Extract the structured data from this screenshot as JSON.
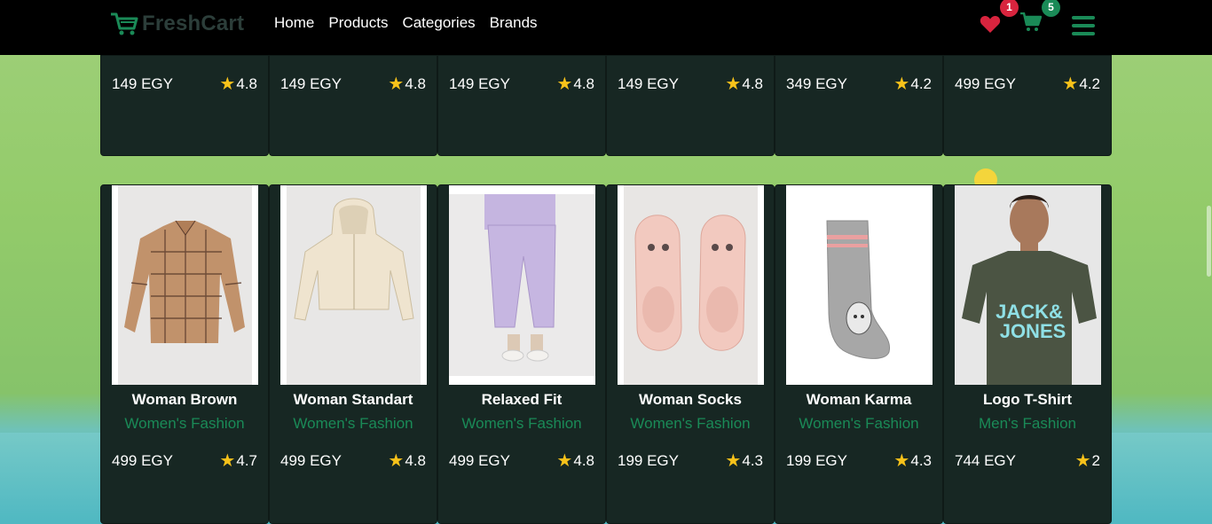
{
  "brand": {
    "name": "FreshCart"
  },
  "nav": {
    "links": [
      "Home",
      "Products",
      "Categories",
      "Brands"
    ],
    "wishlist_count": "1",
    "cart_count": "5"
  },
  "colors": {
    "accent": "#1a8a57",
    "card_bg": "#172723",
    "star": "#f7c21a",
    "badge_red": "#d8243e"
  },
  "top_row": [
    {
      "price": "149 EGY",
      "rating": "4.8"
    },
    {
      "price": "149 EGY",
      "rating": "4.8"
    },
    {
      "price": "149 EGY",
      "rating": "4.8"
    },
    {
      "price": "149 EGY",
      "rating": "4.8"
    },
    {
      "price": "349 EGY",
      "rating": "4.2"
    },
    {
      "price": "499 EGY",
      "rating": "4.2"
    }
  ],
  "products": [
    {
      "title": "Woman Brown",
      "category": "Women's Fashion",
      "price": "499 EGY",
      "rating": "4.7",
      "image": "plaid-shirt"
    },
    {
      "title": "Woman Standart",
      "category": "Women's Fashion",
      "price": "499 EGY",
      "rating": "4.8",
      "image": "cream-hoodie"
    },
    {
      "title": "Relaxed Fit",
      "category": "Women's Fashion",
      "price": "499 EGY",
      "rating": "4.8",
      "image": "lilac-joggers"
    },
    {
      "title": "Woman Socks",
      "category": "Women's Fashion",
      "price": "199 EGY",
      "rating": "4.3",
      "image": "pink-slipper-socks"
    },
    {
      "title": "Woman Karma",
      "category": "Women's Fashion",
      "price": "199 EGY",
      "rating": "4.3",
      "image": "grey-bunny-sock"
    },
    {
      "title": "Logo T-Shirt",
      "category": "Men's Fashion",
      "price": "744 EGY",
      "rating": "2",
      "image": "jack-jones-tshirt"
    }
  ],
  "icons": [
    "cart-logo-icon",
    "heart-icon",
    "cart-icon",
    "menu-icon",
    "star-icon"
  ]
}
